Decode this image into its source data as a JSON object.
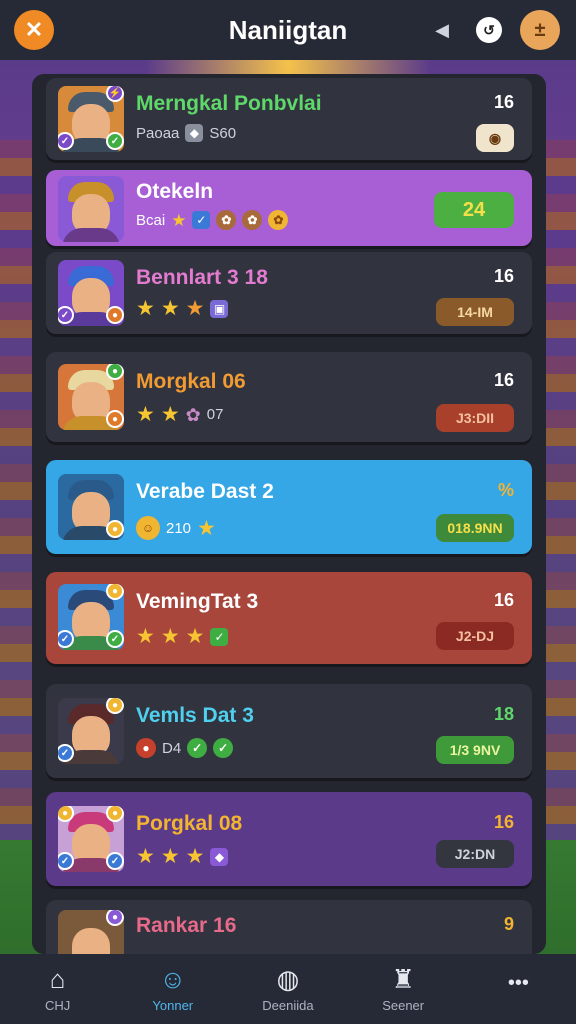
{
  "header": {
    "title": "Naniigtan",
    "close_icon": "✕",
    "sound_icon": "◀",
    "info_icon": "↺",
    "plus_icon": "±"
  },
  "rows": [
    {
      "name": "Merngkal Ponbvlai",
      "name_color": "#5fd86a",
      "sub_text": "Paoaa",
      "sub_value": "S60",
      "score": "16",
      "pill": "",
      "bg": "dark",
      "pill_color": "#f1e4cc",
      "hat": "#4a5a6a",
      "shirt": "#3a4a5a"
    },
    {
      "name": "Otekeln",
      "name_color": "#ffffff",
      "sub_text": "Bcai",
      "sub_value": "",
      "score": "",
      "pill": "24",
      "bg": "purple",
      "pill_color": "#4caf42",
      "hat": "#c7902a",
      "shirt": "#6a3a8a"
    },
    {
      "name": "Bennlart 3 18",
      "name_color": "#e37bd0",
      "sub_text": "",
      "sub_value": "",
      "score": "16",
      "pill": "14-IM",
      "bg": "dark",
      "pill_color": "#8a5a2a",
      "hat": "#3a6ad6",
      "shirt": "#5a3a9a"
    },
    {
      "name": "Morgkal 06",
      "name_color": "#f29b33",
      "sub_text": "",
      "sub_value": "07",
      "score": "16",
      "pill": "J3:DII",
      "bg": "dark",
      "pill_color": "#a8402c",
      "hat": "#e8d8a0",
      "shirt": "#c7902a"
    },
    {
      "name": "Verabe Dast 2",
      "name_color": "#ffffff",
      "sub_text": "",
      "sub_value": "210",
      "score": "%",
      "pill": "018.9NN",
      "bg": "blue",
      "pill_color": "#3f8a3a",
      "hat": "#2a6aa0",
      "shirt": "#2a4a6a"
    },
    {
      "name": "VemingTat 3",
      "name_color": "#ffffff",
      "sub_text": "",
      "sub_value": "",
      "score": "16",
      "pill": "J2-DJ",
      "bg": "red",
      "pill_color": "#8a2a22",
      "hat": "#2a4a7a",
      "shirt": "#3a8a4a"
    },
    {
      "name": "Vemls Dat 3",
      "name_color": "#4fd0ee",
      "sub_text": "",
      "sub_value": "D4",
      "score": "18",
      "pill": "1/3 9NV",
      "bg": "dark",
      "pill_color": "#3f9a3a",
      "hat": "#5a2a2a",
      "shirt": "#3a3a4a"
    },
    {
      "name": "Porgkal 08",
      "name_color": "#f2b431",
      "sub_text": "",
      "sub_value": "",
      "score": "16",
      "pill": "J2:DN",
      "bg": "violet",
      "pill_color": "#34363f",
      "hat": "#c83a7a",
      "shirt": "#8a3a6a"
    },
    {
      "name": "Rankar 16",
      "name_color": "#e86a8a",
      "sub_text": "",
      "sub_value": "",
      "score": "9",
      "pill": "",
      "bg": "dark",
      "pill_color": "#8a3a2a",
      "hat": "#7a5a3a",
      "shirt": "#4a3a3a"
    }
  ],
  "nav": [
    {
      "label": "CHJ",
      "icon": "⌂",
      "active": false
    },
    {
      "label": "Yonner",
      "icon": "☺",
      "active": true
    },
    {
      "label": "Deeniida",
      "icon": "◍",
      "active": false
    },
    {
      "label": "Seener",
      "icon": "♜",
      "active": false
    },
    {
      "label": "",
      "icon": "•••",
      "active": false
    }
  ]
}
